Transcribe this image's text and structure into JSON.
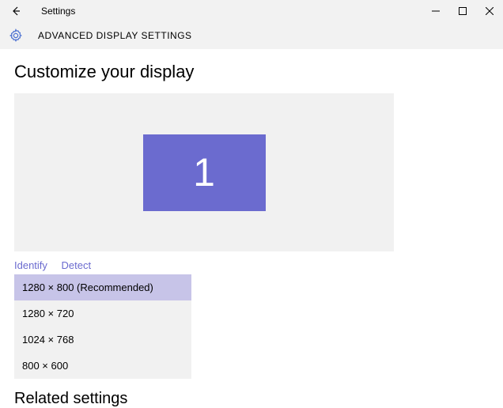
{
  "titlebar": {
    "title": "Settings"
  },
  "subtitle": "Advanced Display Settings",
  "page_heading": "Customize your display",
  "monitor": {
    "number": "1"
  },
  "links": {
    "identify": "Identify",
    "detect": "Detect"
  },
  "resolutions": [
    {
      "label": "1280 × 800 (Recommended)",
      "selected": true
    },
    {
      "label": "1280 × 720",
      "selected": false
    },
    {
      "label": "1024 × 768",
      "selected": false
    },
    {
      "label": "800 × 600",
      "selected": false
    }
  ],
  "related_heading": "Related settings"
}
